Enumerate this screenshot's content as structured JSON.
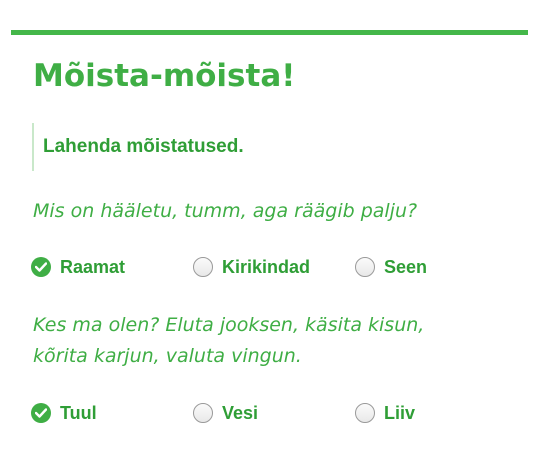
{
  "quiz": {
    "title": "Mõista-mõista!",
    "instruction": "Lahenda mõistatused.",
    "questions": [
      {
        "text": "Mis on hääletu, tumm, aga räägib palju?",
        "options": [
          {
            "label": "Raamat",
            "selected": true
          },
          {
            "label": "Kirikindad",
            "selected": false
          },
          {
            "label": "Seen",
            "selected": false
          }
        ]
      },
      {
        "text_line1": "Kes ma olen? Eluta jooksen, käsita kisun,",
        "text_line2": "kõrita karjun, valuta vingun.",
        "options": [
          {
            "label": "Tuul",
            "selected": true
          },
          {
            "label": "Vesi",
            "selected": false
          },
          {
            "label": "Liiv",
            "selected": false
          }
        ]
      }
    ]
  },
  "colors": {
    "accent": "#44b749",
    "text_green": "#3fae45",
    "label_green": "#2f9e36"
  },
  "icons": {
    "selected": "check-circle-icon",
    "unselected": "radio-empty-icon"
  }
}
